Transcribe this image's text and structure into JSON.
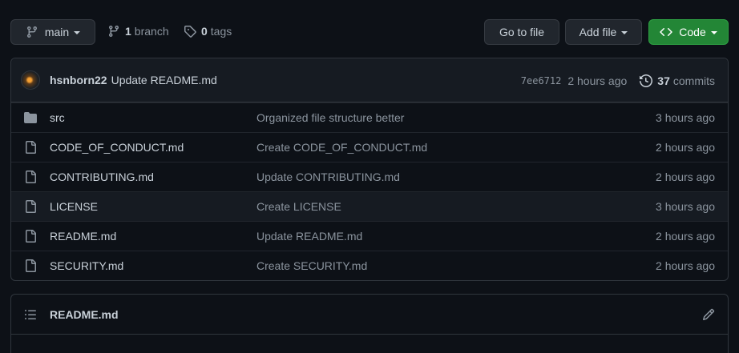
{
  "branch_selector": {
    "label": "main"
  },
  "branches": {
    "count": "1",
    "label": "branch"
  },
  "tags": {
    "count": "0",
    "label": "tags"
  },
  "actions": {
    "goto_file": "Go to file",
    "add_file": "Add file",
    "code": "Code"
  },
  "latest_commit": {
    "author": "hsnborn22",
    "message": "Update README.md",
    "sha": "7ee6712",
    "time": "2 hours ago",
    "commit_count": "37",
    "commit_label": "commits"
  },
  "files": [
    {
      "name": "src",
      "type": "folder",
      "commit": "Organized file structure better",
      "age": "3 hours ago"
    },
    {
      "name": "CODE_OF_CONDUCT.md",
      "type": "file",
      "commit": "Create CODE_OF_CONDUCT.md",
      "age": "2 hours ago"
    },
    {
      "name": "CONTRIBUTING.md",
      "type": "file",
      "commit": "Update CONTRIBUTING.md",
      "age": "2 hours ago"
    },
    {
      "name": "LICENSE",
      "type": "file",
      "commit": "Create LICENSE",
      "age": "3 hours ago"
    },
    {
      "name": "README.md",
      "type": "file",
      "commit": "Update README.md",
      "age": "2 hours ago"
    },
    {
      "name": "SECURITY.md",
      "type": "file",
      "commit": "Create SECURITY.md",
      "age": "2 hours ago"
    }
  ],
  "readme": {
    "title": "README.md"
  },
  "colors": {
    "background": "#0d1117",
    "header_bg": "#161b22",
    "border": "#30363d",
    "primary_button": "#238636",
    "muted_text": "#8b949e",
    "text": "#c9d1d9"
  }
}
